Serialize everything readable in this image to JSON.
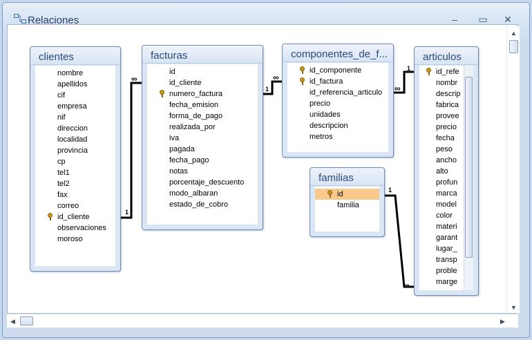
{
  "window": {
    "title": "Relaciones",
    "minimize_glyph": "–",
    "maximize_glyph": "▭",
    "close_glyph": "✕"
  },
  "icons": [
    "relationships-icon",
    "key-icon",
    "scroll-up-arrow-icon",
    "scroll-down-arrow-icon",
    "scroll-left-arrow-icon",
    "scroll-right-arrow-icon"
  ],
  "colors": {
    "selected_field_bg": "#f9c88c",
    "title_text": "#2c4a78",
    "key_icon": "#c89a1c"
  },
  "tables": {
    "clientes": {
      "title": "clientes",
      "fields": [
        {
          "name": "nombre",
          "key": false
        },
        {
          "name": "apellidos",
          "key": false
        },
        {
          "name": "cif",
          "key": false
        },
        {
          "name": "empresa",
          "key": false
        },
        {
          "name": "nif",
          "key": false
        },
        {
          "name": "direccion",
          "key": false
        },
        {
          "name": "localidad",
          "key": false
        },
        {
          "name": "provincia",
          "key": false
        },
        {
          "name": "cp",
          "key": false
        },
        {
          "name": "tel1",
          "key": false
        },
        {
          "name": "tel2",
          "key": false
        },
        {
          "name": "fax",
          "key": false
        },
        {
          "name": "correo",
          "key": false
        },
        {
          "name": "id_cliente",
          "key": true
        },
        {
          "name": "observaciones",
          "key": false
        },
        {
          "name": "moroso",
          "key": false
        }
      ]
    },
    "facturas": {
      "title": "facturas",
      "fields": [
        {
          "name": "id",
          "key": false
        },
        {
          "name": "id_cliente",
          "key": false
        },
        {
          "name": "numero_factura",
          "key": true
        },
        {
          "name": "fecha_emision",
          "key": false
        },
        {
          "name": "forma_de_pago",
          "key": false
        },
        {
          "name": "realizada_por",
          "key": false
        },
        {
          "name": "iva",
          "key": false
        },
        {
          "name": "pagada",
          "key": false
        },
        {
          "name": "fecha_pago",
          "key": false
        },
        {
          "name": "notas",
          "key": false
        },
        {
          "name": "porcentaje_descuento",
          "key": false
        },
        {
          "name": "modo_albaran",
          "key": false
        },
        {
          "name": "estado_de_cobro",
          "key": false
        }
      ]
    },
    "componentes": {
      "title": "componentes_de_f...",
      "fields": [
        {
          "name": "id_componente",
          "key": true
        },
        {
          "name": "id_factura",
          "key": true
        },
        {
          "name": "id_referencia_articulo",
          "key": false
        },
        {
          "name": "precio",
          "key": false
        },
        {
          "name": "unidades",
          "key": false
        },
        {
          "name": "descripcion",
          "key": false
        },
        {
          "name": "metros",
          "key": false
        }
      ]
    },
    "familias": {
      "title": "familias",
      "fields": [
        {
          "name": "id",
          "key": true,
          "selected": true
        },
        {
          "name": "familia",
          "key": false
        }
      ]
    },
    "articulos": {
      "title": "articulos",
      "fields": [
        {
          "name": "id_refe",
          "key": true
        },
        {
          "name": "nombr",
          "key": false
        },
        {
          "name": "descrip",
          "key": false
        },
        {
          "name": "fabrica",
          "key": false
        },
        {
          "name": "provee",
          "key": false
        },
        {
          "name": "precio",
          "key": false
        },
        {
          "name": "fecha",
          "key": false
        },
        {
          "name": "peso",
          "key": false
        },
        {
          "name": "ancho",
          "key": false
        },
        {
          "name": "alto",
          "key": false
        },
        {
          "name": "profun",
          "key": false
        },
        {
          "name": "marca",
          "key": false
        },
        {
          "name": "model",
          "key": false
        },
        {
          "name": "color",
          "key": false
        },
        {
          "name": "materi",
          "key": false
        },
        {
          "name": "garant",
          "key": false
        },
        {
          "name": "lugar_",
          "key": false
        },
        {
          "name": "transp",
          "key": false
        },
        {
          "name": "proble",
          "key": false
        },
        {
          "name": "marge",
          "key": false
        }
      ]
    }
  },
  "relations": {
    "one_label": "1",
    "many_label": "∞"
  }
}
